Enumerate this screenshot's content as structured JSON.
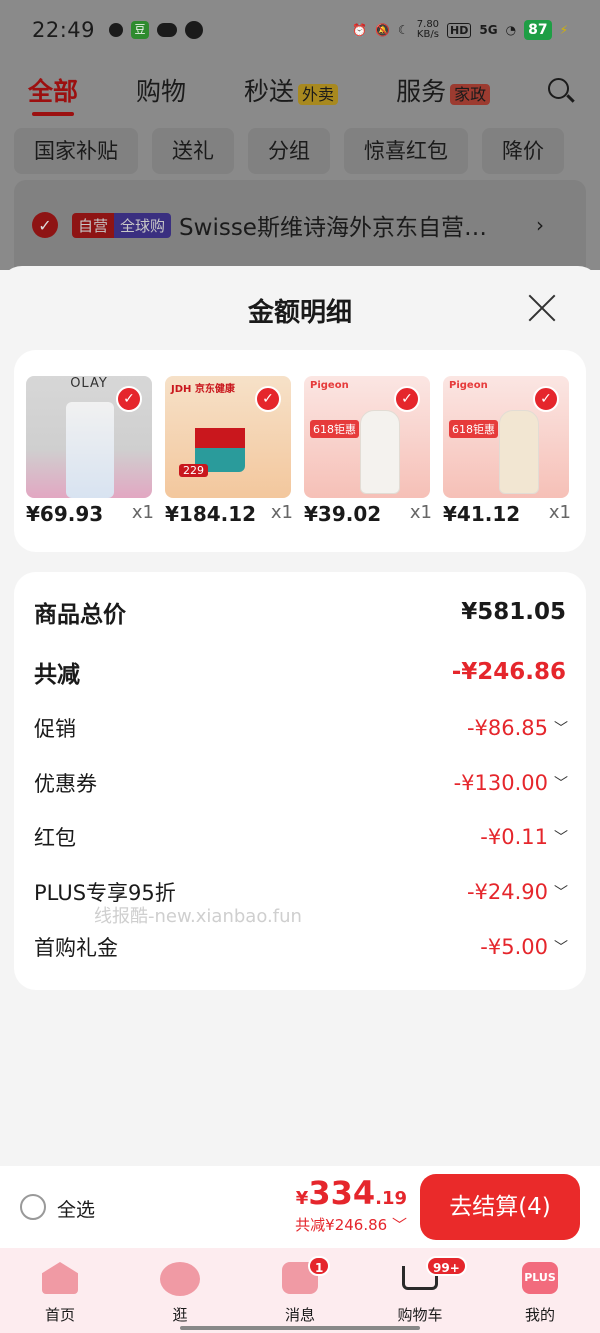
{
  "status_bar": {
    "time": "22:49",
    "douban": "豆",
    "net_speed_value": "7.80",
    "net_speed_unit": "KB/s",
    "hd": "HD",
    "signal": "5G",
    "battery": "87"
  },
  "top_tabs": [
    {
      "label": "全部",
      "badge": ""
    },
    {
      "label": "购物",
      "badge": ""
    },
    {
      "label": "秒送",
      "badge": "外卖"
    },
    {
      "label": "服务",
      "badge": "家政"
    }
  ],
  "filters": [
    "国家补贴",
    "送礼",
    "分组",
    "惊喜红包",
    "降价"
  ],
  "store": {
    "tag1": "自营",
    "tag2": "全球购",
    "name": "Swisse斯维诗海外京东自营…",
    "chevron": "›"
  },
  "sheet": {
    "title": "金额明细"
  },
  "products": [
    {
      "price": "¥69.93",
      "qty": "x1",
      "brand": "OLAY"
    },
    {
      "price": "¥184.12",
      "qty": "x1",
      "brand": "JDH 京东健康",
      "tag": "229"
    },
    {
      "price": "¥39.02",
      "qty": "x1",
      "brand": "Pigeon",
      "tag": "618钜惠"
    },
    {
      "price": "¥41.12",
      "qty": "x1",
      "brand": "Pigeon",
      "tag": "618钜惠"
    }
  ],
  "details": {
    "subtotal_label": "商品总价",
    "subtotal_value": "¥581.05",
    "total_discount_label": "共减",
    "total_discount_value": "-¥246.86",
    "items": [
      {
        "label": "促销",
        "value": "-¥86.85"
      },
      {
        "label": "优惠券",
        "value": "-¥130.00"
      },
      {
        "label": "红包",
        "value": "-¥0.11"
      },
      {
        "label": "PLUS专享95折",
        "value": "-¥24.90"
      },
      {
        "label": "首购礼金",
        "value": "-¥5.00"
      }
    ],
    "watermark": "线报酷-new.xianbao.fun"
  },
  "checkout": {
    "select_all": "全选",
    "currency": "¥",
    "total_int": "334",
    "total_dec": ".19",
    "saved": "共减¥246.86",
    "button": "去结算(4)"
  },
  "bottom_nav": [
    {
      "label": "首页",
      "badge": ""
    },
    {
      "label": "逛",
      "badge": ""
    },
    {
      "label": "消息",
      "badge": "1"
    },
    {
      "label": "购物车",
      "badge": "99+"
    },
    {
      "label": "我的",
      "badge": ""
    }
  ],
  "plus_icon_text": "PLUS",
  "colors": {
    "accent_red": "#e5262c",
    "checkout_button": "#ea2a2a",
    "nav_background": "#fdecef"
  }
}
